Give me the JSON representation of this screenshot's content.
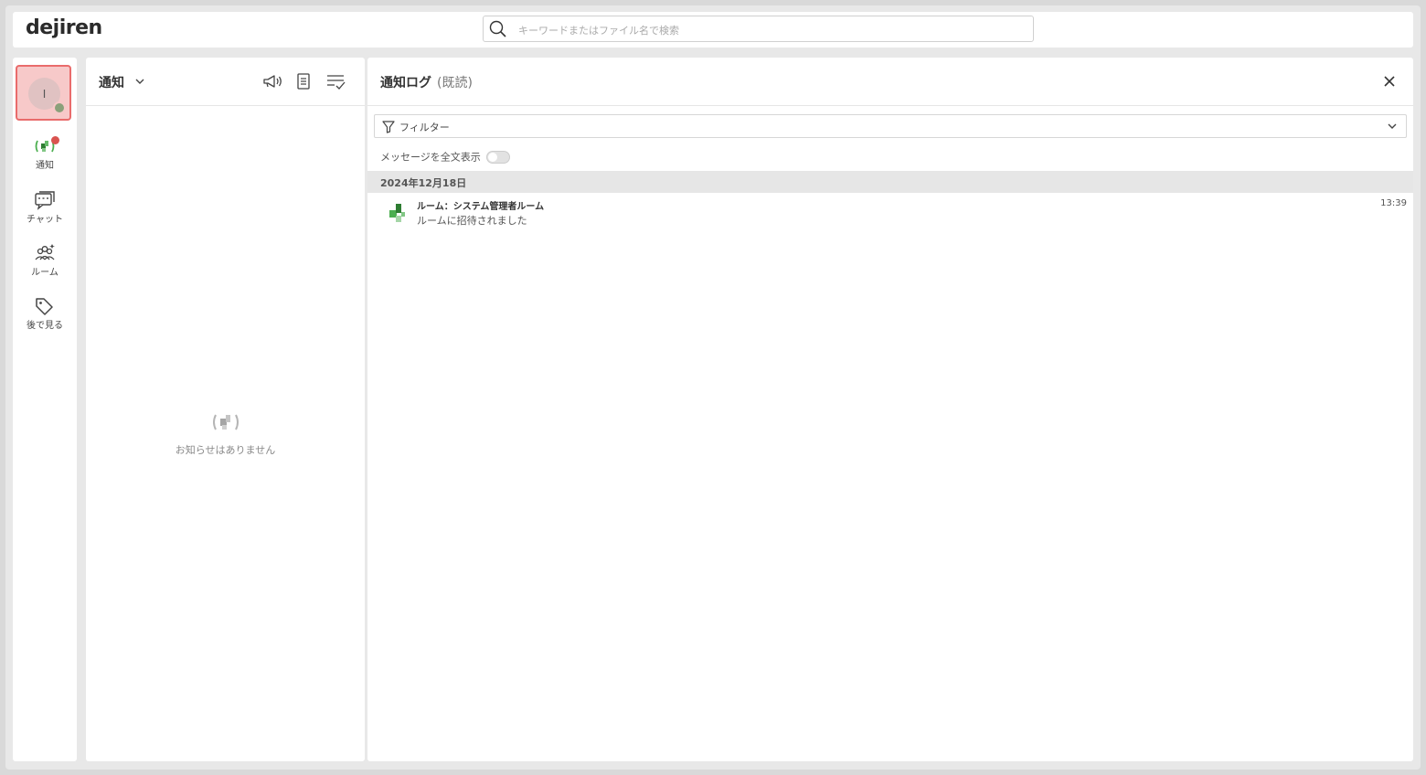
{
  "app": {
    "logo": "dejiren"
  },
  "search": {
    "placeholder": "キーワードまたはファイル名で検索"
  },
  "user": {
    "initial": "I"
  },
  "nav": [
    {
      "label": "通知",
      "icon": "broadcast-icon"
    },
    {
      "label": "チャット",
      "icon": "chat-icon"
    },
    {
      "label": "ルーム",
      "icon": "room-icon"
    },
    {
      "label": "後で見る",
      "icon": "tag-icon"
    }
  ],
  "notifications": {
    "title": "通知",
    "empty_text": "お知らせはありません"
  },
  "log": {
    "title": "通知ログ",
    "subtitle": "(既読)",
    "filter_label": "フィルター",
    "fulltext_label": "メッセージを全文表示",
    "date_group": "2024年12月18日",
    "items": [
      {
        "room": "ルーム：システム管理者ルーム",
        "message": "ルームに招待されました",
        "time": "13:39"
      }
    ]
  },
  "colors": {
    "accent": "#4caf50",
    "badge": "#d9534f",
    "avatar_border": "#e96b6b"
  }
}
